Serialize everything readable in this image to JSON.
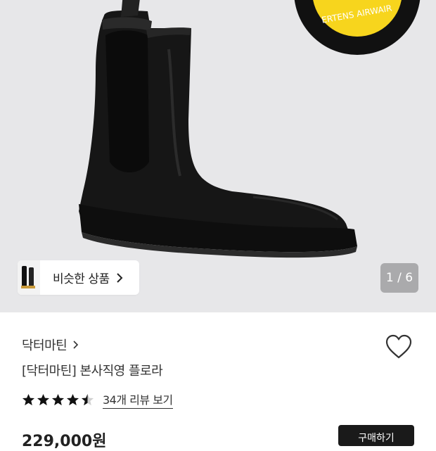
{
  "gallery": {
    "similar_label": "비슷한 상품",
    "counter": "1 / 6"
  },
  "product": {
    "brand": "닥터마틴",
    "title": "[닥터마틴] 본사직영 플로라",
    "rating": 4.5,
    "review_link": "34개 리뷰 보기",
    "price": "229,000원",
    "buy_label": "구매하기"
  },
  "colors": {
    "hero_bg": "#e7e7e9",
    "star": "#111111",
    "button": "#1a1a1a"
  },
  "icons": [
    "heart-icon",
    "chevron-right-icon",
    "star-icon",
    "half-star-icon"
  ]
}
